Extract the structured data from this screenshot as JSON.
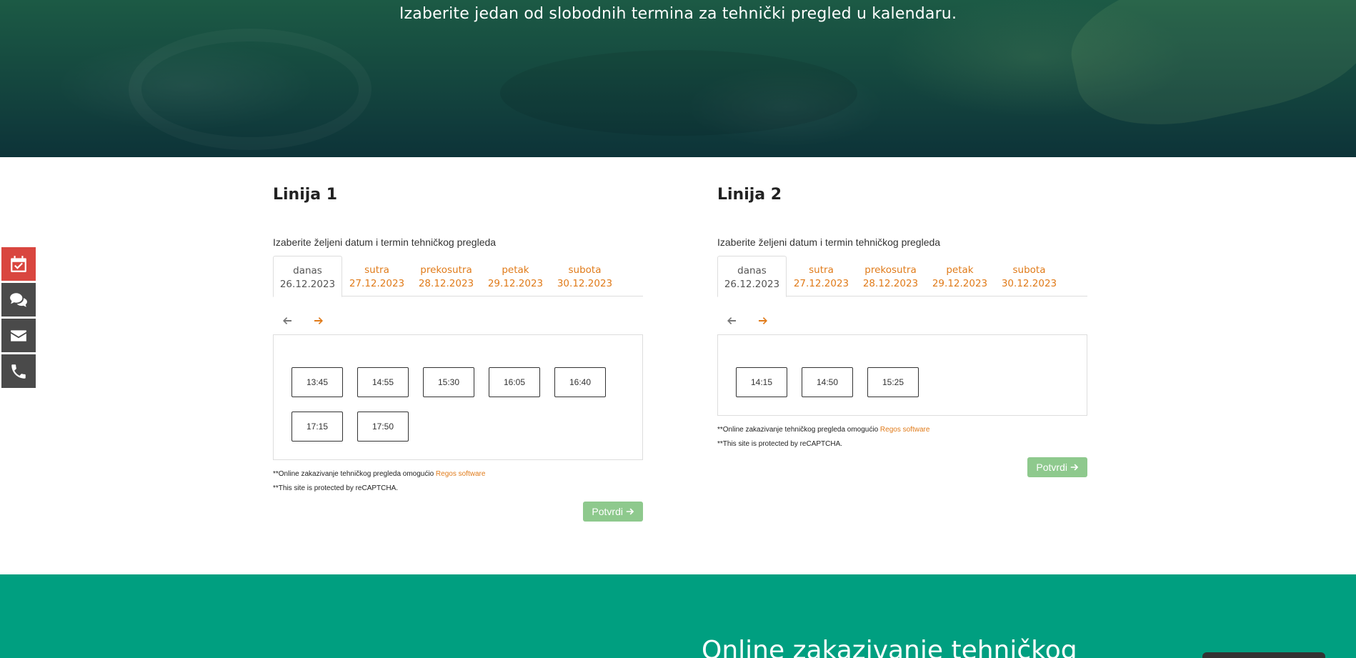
{
  "hero": {
    "subtitle": "Izaberite jedan od slobodnih termina za tehnički pregled u kalendaru."
  },
  "sidebar": {
    "items": [
      {
        "name": "calendar-check-icon",
        "color": "#d9463f"
      },
      {
        "name": "chat-icon",
        "color": "#4a4a4a"
      },
      {
        "name": "envelope-icon",
        "color": "#4a4a4a"
      },
      {
        "name": "phone-icon",
        "color": "#4a4a4a"
      }
    ]
  },
  "lines": [
    {
      "title": "Linija 1",
      "instruction": "Izaberite željeni datum i termin tehničkog pregleda",
      "tabs": [
        {
          "day": "danas",
          "date": "26.12.2023",
          "active": true
        },
        {
          "day": "sutra",
          "date": "27.12.2023"
        },
        {
          "day": "prekosutra",
          "date": "28.12.2023"
        },
        {
          "day": "petak",
          "date": "29.12.2023"
        },
        {
          "day": "subota",
          "date": "30.12.2023"
        }
      ],
      "slots": [
        "13:45",
        "14:55",
        "15:30",
        "16:05",
        "16:40",
        "17:15",
        "17:50"
      ],
      "note1_prefix": "**Online zakazivanje tehničkog pregleda omogućio ",
      "note1_link": "Regos software",
      "note2": "**This site is protected by reCAPTCHA.",
      "confirm_label": "Potvrdi"
    },
    {
      "title": "Linija 2",
      "instruction": "Izaberite željeni datum i termin tehničkog pregleda",
      "tabs": [
        {
          "day": "danas",
          "date": "26.12.2023",
          "active": true
        },
        {
          "day": "sutra",
          "date": "27.12.2023"
        },
        {
          "day": "prekosutra",
          "date": "28.12.2023"
        },
        {
          "day": "petak",
          "date": "29.12.2023"
        },
        {
          "day": "subota",
          "date": "30.12.2023"
        }
      ],
      "slots": [
        "14:15",
        "14:50",
        "15:25"
      ],
      "note1_prefix": "**Online zakazivanje tehničkog pregleda omogućio ",
      "note1_link": "Regos software",
      "note2": "**This site is protected by reCAPTCHA.",
      "confirm_label": "Potvrdi"
    }
  ],
  "band": {
    "title": "Online zakazivanje tehničkog"
  },
  "colors": {
    "accent": "#e07b1a",
    "confirm": "#8ec98d",
    "band": "#009f80",
    "side_active": "#d9463f"
  }
}
